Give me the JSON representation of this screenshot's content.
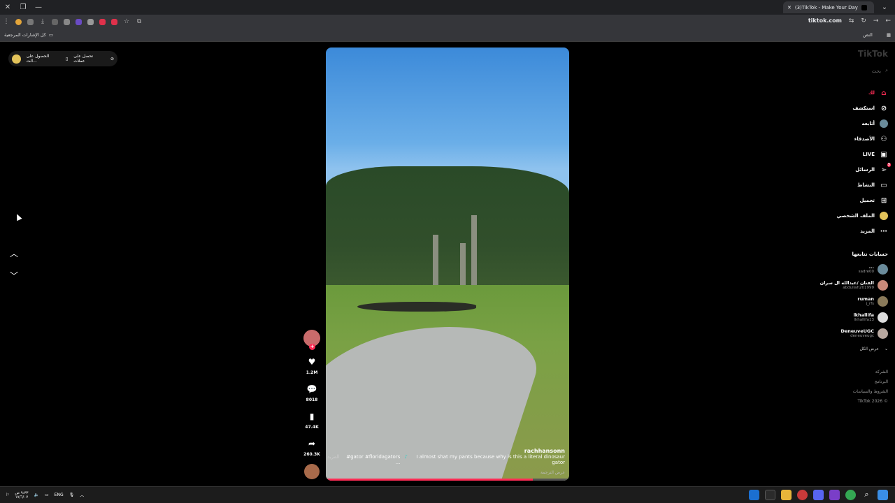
{
  "browser": {
    "tab_title": "(3)TikTok - Make Your Day",
    "url": "tiktok.com",
    "bookmarks_label": "كل الإشارات المرجعية",
    "bookmarks_right": "النص"
  },
  "promo": {
    "item1": "تحصل على عملات",
    "item2": "الحصول على الت..."
  },
  "video": {
    "username": "rachhansonn",
    "caption": "I almost shat my pants because why is this a literal dinosaur gator",
    "hashtags": "#gator #floridagators ...",
    "more_label": "المزيد",
    "translate_label": "عرض الترجمة",
    "progress_fraction": 0.85
  },
  "actions": {
    "likes": "1.2M",
    "comments": "8018",
    "saves": "47.4K",
    "shares": "260.3K"
  },
  "sidebar": {
    "logo": "TikTok",
    "search_placeholder": "بحث",
    "nav": [
      {
        "label": "لك",
        "icon": "home-icon"
      },
      {
        "label": "استكشف",
        "icon": "compass-icon"
      },
      {
        "label": "أتابعه",
        "icon": "following-icon"
      },
      {
        "label": "الأصدقاء",
        "icon": "friends-icon"
      },
      {
        "label": "LIVE",
        "icon": "live-icon"
      },
      {
        "label": "الرسائل",
        "icon": "messages-icon"
      },
      {
        "label": "النشاط",
        "icon": "activity-icon"
      },
      {
        "label": "تحميل",
        "icon": "upload-icon"
      },
      {
        "label": "الملف الشخصي",
        "icon": "profile-icon"
      },
      {
        "label": "المزيد",
        "icon": "more-icon"
      }
    ],
    "messages_badge": "3",
    "following_title": "حسابات تتابعها",
    "following": [
      {
        "name": "...",
        "user": "sadre00"
      },
      {
        "name": "الفنان /عبدالله ال سران",
        "user": "abdullah201999"
      },
      {
        "name": "ruman",
        "user": "j_rfs"
      },
      {
        "name": "lkhallifa",
        "user": "lkhallifa13"
      },
      {
        "name": "DeneuveUGC",
        "user": "deneuveugc"
      }
    ],
    "show_all": "عرض الكل",
    "footer": [
      "الشركة",
      "البرنامج",
      "الشروط والسياسات",
      "© 2026 TikTok"
    ]
  },
  "taskbar": {
    "lang": "ENG",
    "time": "٩:٣٣ ص",
    "date": "١٧/٦/٠٧"
  },
  "colors": {
    "accent": "#fe2c55",
    "background": "#000000"
  }
}
